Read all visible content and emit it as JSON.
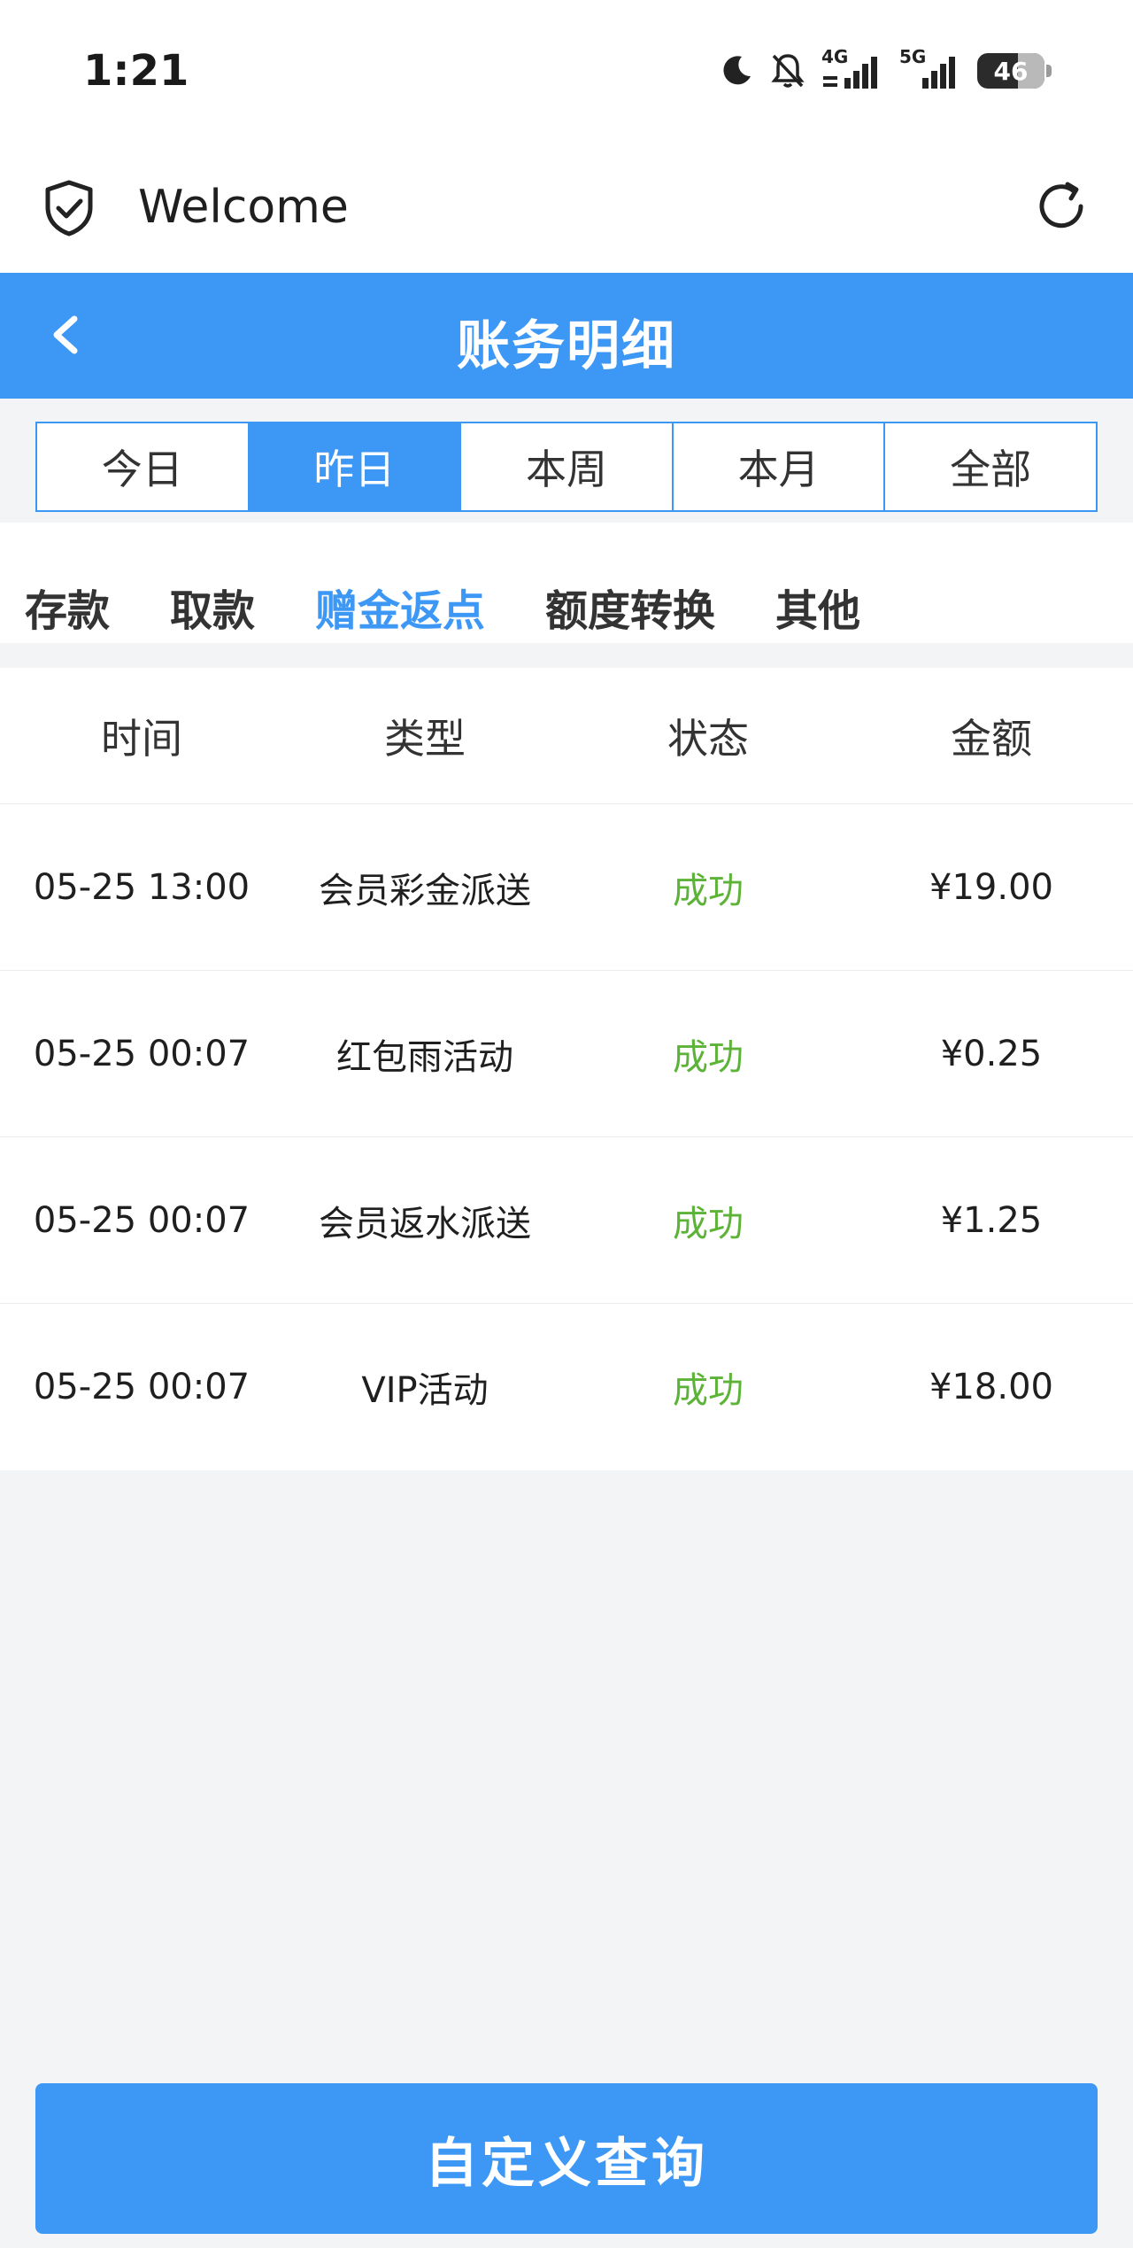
{
  "status_bar": {
    "time": "1:21",
    "network_4g": "4G",
    "network_5g": "5G",
    "battery": "46"
  },
  "app_bar": {
    "title": "Welcome"
  },
  "nav": {
    "title": "账务明细"
  },
  "date_tabs": [
    {
      "label": "今日",
      "active": false
    },
    {
      "label": "昨日",
      "active": true
    },
    {
      "label": "本周",
      "active": false
    },
    {
      "label": "本月",
      "active": false
    },
    {
      "label": "全部",
      "active": false
    }
  ],
  "categories": [
    {
      "label": "存款",
      "active": false
    },
    {
      "label": "取款",
      "active": false
    },
    {
      "label": "赠金返点",
      "active": true
    },
    {
      "label": "额度转换",
      "active": false
    },
    {
      "label": "其他",
      "active": false
    }
  ],
  "table": {
    "headers": [
      "时间",
      "类型",
      "状态",
      "金额"
    ],
    "rows": [
      [
        "05-25 13:00",
        "会员彩金派送",
        "成功",
        "¥19.00"
      ],
      [
        "05-25 00:07",
        "红包雨活动",
        "成功",
        "¥0.25"
      ],
      [
        "05-25 00:07",
        "会员返水派送",
        "成功",
        "¥1.25"
      ],
      [
        "05-25 00:07",
        "VIP活动",
        "成功",
        "¥18.00"
      ]
    ]
  },
  "actions": {
    "custom_query": "自定义查询"
  },
  "colors": {
    "accent": "#3d97f5",
    "success": "#5cb338",
    "background": "#f3f4f6"
  },
  "icons": {
    "moon": "moon-icon",
    "mute": "bell-off-icon",
    "signal": "signal-icon",
    "shield": "shield-check-icon",
    "refresh": "refresh-icon",
    "back": "chevron-left-icon"
  }
}
